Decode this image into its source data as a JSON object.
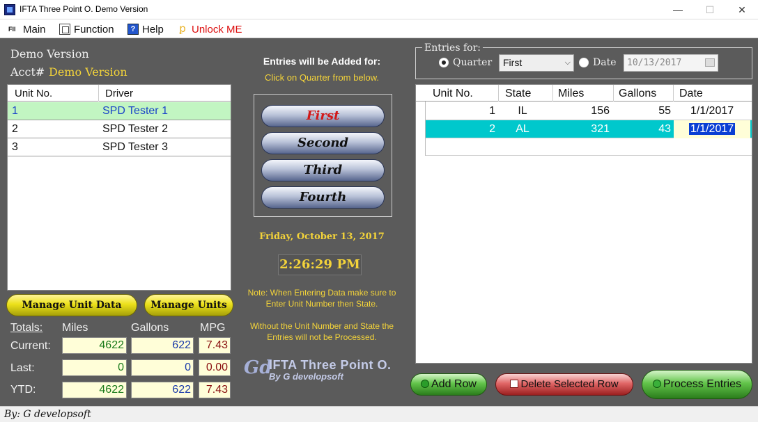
{
  "window": {
    "title": "IFTA Three Point O. Demo Version",
    "min_glyph": "—",
    "max_glyph": "☐",
    "close_glyph": "✕"
  },
  "menu": {
    "main_icon_text": "FIl",
    "main": "Main",
    "function": "Function",
    "help_icon_text": "?",
    "help": "Help",
    "unlock_icon_text": "ꝑ",
    "unlock": "Unlock ME"
  },
  "account": {
    "version_label": "Demo Version",
    "acct_label": "Acct#",
    "acct_value": "Demo Version"
  },
  "units_table": {
    "headers": [
      "Unit No.",
      "Driver"
    ],
    "rows": [
      {
        "unit": "1",
        "driver": "SPD Tester 1",
        "selected": true
      },
      {
        "unit": "2",
        "driver": "SPD Tester 2",
        "selected": false
      },
      {
        "unit": "3",
        "driver": "SPD Tester 3",
        "selected": false
      }
    ]
  },
  "left_buttons": {
    "manage_unit_data": "Manage Unit Data",
    "manage_units": "Manage Units"
  },
  "totals": {
    "title": "Totals:",
    "miles_header": "Miles",
    "gallons_header": "Gallons",
    "mpg_header": "MPG",
    "rows": [
      {
        "label": "Current:",
        "miles": "4622",
        "gallons": "622",
        "mpg": "7.43"
      },
      {
        "label": "Last:",
        "miles": "0",
        "gallons": "0",
        "mpg": "0.00"
      },
      {
        "label": "YTD:",
        "miles": "4622",
        "gallons": "622",
        "mpg": "7.43"
      }
    ]
  },
  "middle": {
    "entries_title": "Entries will be Added for:",
    "entries_subtitle": "Click on Quarter from below.",
    "quarters": [
      "First",
      "Second",
      "Third",
      "Fourth"
    ],
    "active_quarter": "First",
    "date": "Friday, October 13, 2017",
    "time": "2:26:29 PM",
    "note1": "Note: When Entering Data make sure to Enter Unit Number then State.",
    "note2": "Without the Unit Number and State the Entries will not be Processed.",
    "logo_g": "Gd",
    "logo_title": "IFTA Three Point O.",
    "logo_by": "By G developsoft"
  },
  "entries_for": {
    "legend": "Entries for:",
    "quarter_label": "Quarter",
    "quarter_selected": true,
    "quarter_value": "First",
    "date_label": "Date",
    "date_value": "10/13/2017"
  },
  "entries_table": {
    "headers": [
      "Unit No.",
      "State",
      "Miles",
      "Gallons",
      "Date"
    ],
    "rows": [
      {
        "unit": "1",
        "state": "IL",
        "miles": "156",
        "gallons": "55",
        "date": "1/1/2017",
        "selected": false
      },
      {
        "unit": "2",
        "state": "AL",
        "miles": "321",
        "gallons": "43",
        "date": "1/1/2017",
        "selected": true
      }
    ]
  },
  "right_buttons": {
    "add_row": "Add Row",
    "delete_row": "Delete Selected Row",
    "process": "Process Entries"
  },
  "status": {
    "text": "By: G developsoft"
  },
  "colors": {
    "background": "#5b5b5b",
    "accent_yellow": "#f3d33a",
    "selected_unit_row": "#c2f5c2",
    "selected_entry_row": "#00c8cc",
    "active_quarter_text": "#d21818"
  }
}
